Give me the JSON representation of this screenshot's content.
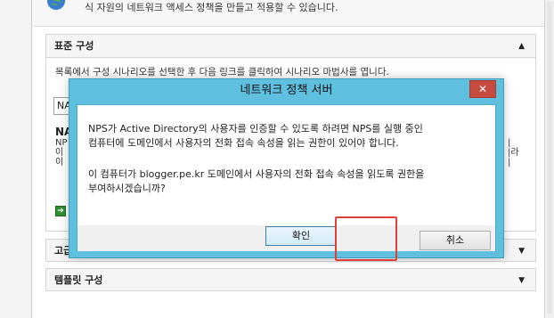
{
  "top": {
    "text": "식 자원의 네트워크 액세스 정책을 만들고 적용할 수 있습니다."
  },
  "standard": {
    "title": "표준 구성",
    "description": "목록에서 구성 시나리오를 선택한 후 다음 링크를 클릭하여 시나리오 마법사를 엽니다.",
    "select_value": "NA",
    "bold_text": "NA",
    "lines": [
      "NP",
      "이",
      "이"
    ],
    "right_lines": [
      "|",
      "|라",
      "|"
    ]
  },
  "advanced": {
    "title": "고급"
  },
  "templates": {
    "title": "템플릿 구성"
  },
  "dialog": {
    "title": "네트워크 정책 서버",
    "close_label": "✕",
    "message_line1": "NPS가 Active Directory의 사용자를 인증할 수 있도록 하려면 NPS를 실행 중인",
    "message_line2": "컴퓨터에 도메인에서 사용자의 전화 접속 속성을 읽는 권한이 있어야 합니다.",
    "question_line1": "이 컴퓨터가 blogger.pe.kr 도메인에서 사용자의 전화 접속 속성을 읽도록 권한을",
    "question_line2": "부여하시겠습니까?",
    "ok_label": "확인",
    "cancel_label": "취소"
  },
  "colors": {
    "dialog_frame": "#5ebfdf",
    "close_button": "#c74b3f",
    "highlight": "#e0403a"
  }
}
